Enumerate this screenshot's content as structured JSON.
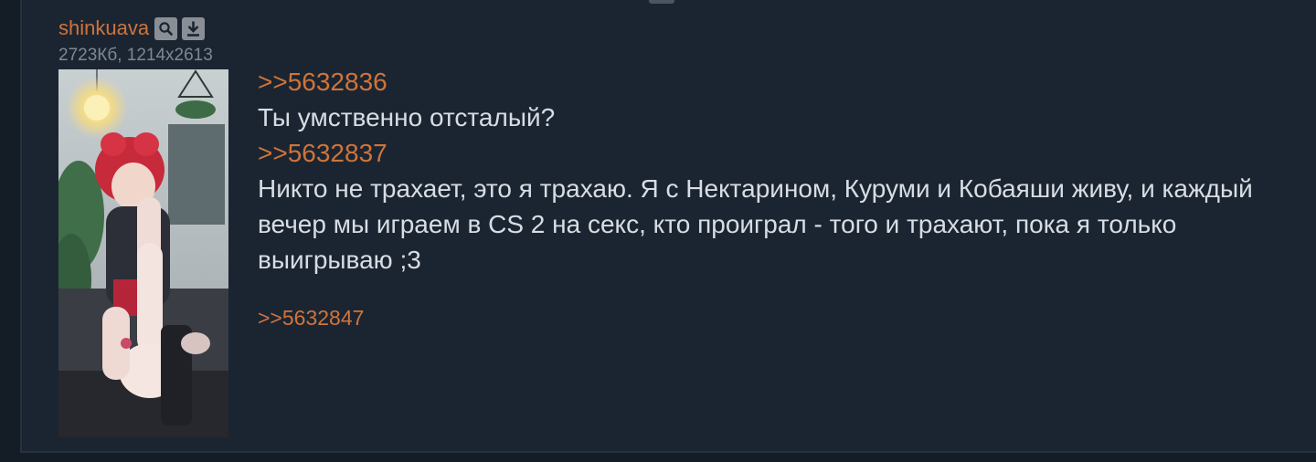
{
  "post": {
    "filename": "shinkuava",
    "fileinfo": "2723Кб, 1214x2613",
    "icons": {
      "search": "search-icon",
      "download": "download-icon"
    },
    "thumbnail_alt": "anime girl with red hair, thumbnail",
    "lines": [
      {
        "type": "quote",
        "text": ">>5632836"
      },
      {
        "type": "text",
        "text": "Ты умственно отсталый?"
      },
      {
        "type": "quote",
        "text": ">>5632837"
      },
      {
        "type": "text",
        "text": "Никто не трахает, это я трахаю. Я с Нектарином, Куруми и Кобаяши живу, и каждый вечер мы играем в CS 2 на секс, кто проиграл - того и трахают, пока я только выигрываю ;3"
      }
    ],
    "reply": ">>5632847"
  },
  "colors": {
    "background": "#141c26",
    "post_background": "#1b2532",
    "link": "#d0743a",
    "text": "#d8dde3",
    "muted": "#7f8791"
  }
}
